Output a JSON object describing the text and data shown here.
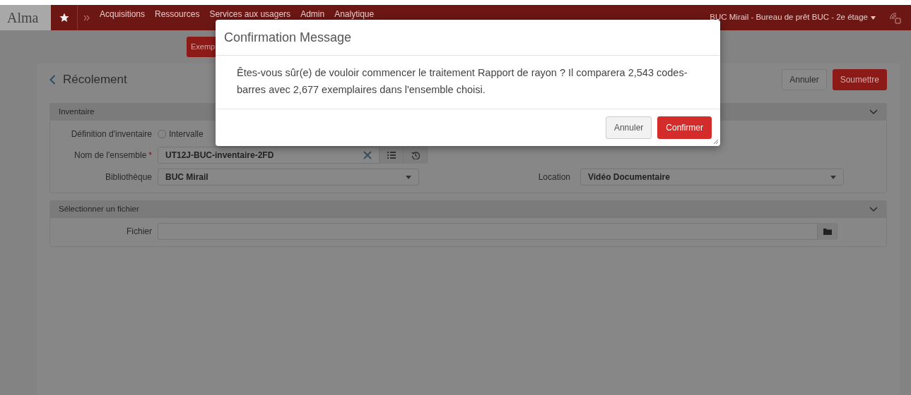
{
  "navbar": {
    "logo": "Alma",
    "menu": [
      "Acquisitions",
      "Ressources",
      "Services aux usagers",
      "Admin",
      "Analytique"
    ],
    "location": "BUC Mirail - Bureau de prêt BUC - 2e étage"
  },
  "toolbar": {
    "button": "Exemp"
  },
  "page": {
    "title": "Récolement",
    "buttons": [
      {
        "label": "Annuler",
        "kind": "secondary"
      },
      {
        "label": "Soumettre",
        "kind": "primary"
      }
    ]
  },
  "inventory": {
    "title": "Inventaire",
    "definition": {
      "label": "Définition d'inventaire",
      "option": "Intervalle",
      "selected": false
    },
    "set": {
      "label": "Nom de l'ensemble",
      "required_mark": "*",
      "value": "UT12J-BUC-inventaire-2FD"
    },
    "library": {
      "label": "Bibliothèque",
      "value": "BUC Mirail"
    },
    "location": {
      "label": "Location",
      "value": "Vidéo Documentaire"
    }
  },
  "file_section": {
    "title": "Sélectionner un fichier",
    "field": {
      "label": "Fichier"
    }
  },
  "modal": {
    "title": "Confirmation Message",
    "message": "Êtes-vous sûr(e) de vouloir commencer le traitement Rapport de rayon ? Il comparera 2,543 codes-barres avec 2,677 exemplaires dans l'ensemble choisi.",
    "buttons": [
      {
        "label": "Annuler",
        "kind": "secondary"
      },
      {
        "label": "Confirmer",
        "kind": "primary"
      }
    ]
  }
}
